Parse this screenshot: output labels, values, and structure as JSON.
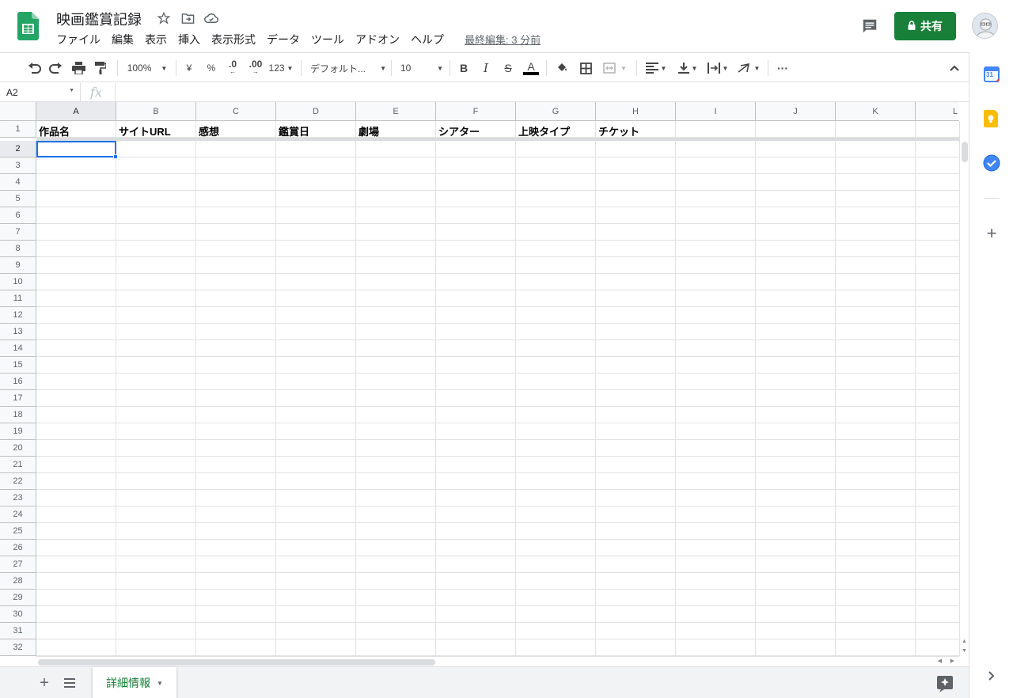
{
  "document": {
    "title": "映画鑑賞記録",
    "last_edit": "最終編集: 3 分前"
  },
  "menu": [
    "ファイル",
    "編集",
    "表示",
    "挿入",
    "表示形式",
    "データ",
    "ツール",
    "アドオン",
    "ヘルプ"
  ],
  "share_label": "共有",
  "toolbar": {
    "zoom": "100%",
    "currency": "¥",
    "percent": "%",
    "decrease_decimal": ".0",
    "increase_decimal": ".00",
    "more_formats": "123",
    "font": "デフォルト...",
    "font_size": "10",
    "bold": "B",
    "italic": "I",
    "strike": "S",
    "text_color": "A",
    "text_color_value": "#000000",
    "more": "···"
  },
  "name_box": "A2",
  "fx_label": "fx",
  "columns": [
    "A",
    "B",
    "C",
    "D",
    "E",
    "F",
    "G",
    "H",
    "I",
    "J",
    "K",
    "L"
  ],
  "rows": [
    "1",
    "2",
    "3",
    "4",
    "5",
    "6",
    "7",
    "8",
    "9",
    "10",
    "11",
    "12",
    "13",
    "14",
    "15",
    "16",
    "17",
    "18",
    "19",
    "20",
    "21",
    "22",
    "23",
    "24",
    "25",
    "26",
    "27",
    "28",
    "29",
    "30",
    "31",
    "32"
  ],
  "header_cells": [
    "作品名",
    "サイトURL",
    "感想",
    "鑑賞日",
    "劇場",
    "シアター",
    "上映タイプ",
    "チケット",
    "",
    "",
    "",
    ""
  ],
  "selected_cell": "A2",
  "sheet_tab": "詳細情報",
  "colors": {
    "accent_green": "#188038",
    "selection_blue": "#1a73e8",
    "header_bg": "#f8f9fa"
  },
  "icons": {
    "logo": "sheets-logo-icon",
    "star": "star-icon",
    "move": "move-to-folder-icon",
    "cloud": "cloud-status-icon",
    "comment": "comment-history-icon",
    "lock": "lock-icon",
    "calendar": "calendar-icon",
    "keep": "keep-icon",
    "tasks": "tasks-icon",
    "addon": "plus-icon",
    "explore": "explore-icon"
  },
  "side_panel": {
    "calendar_day": "31"
  }
}
